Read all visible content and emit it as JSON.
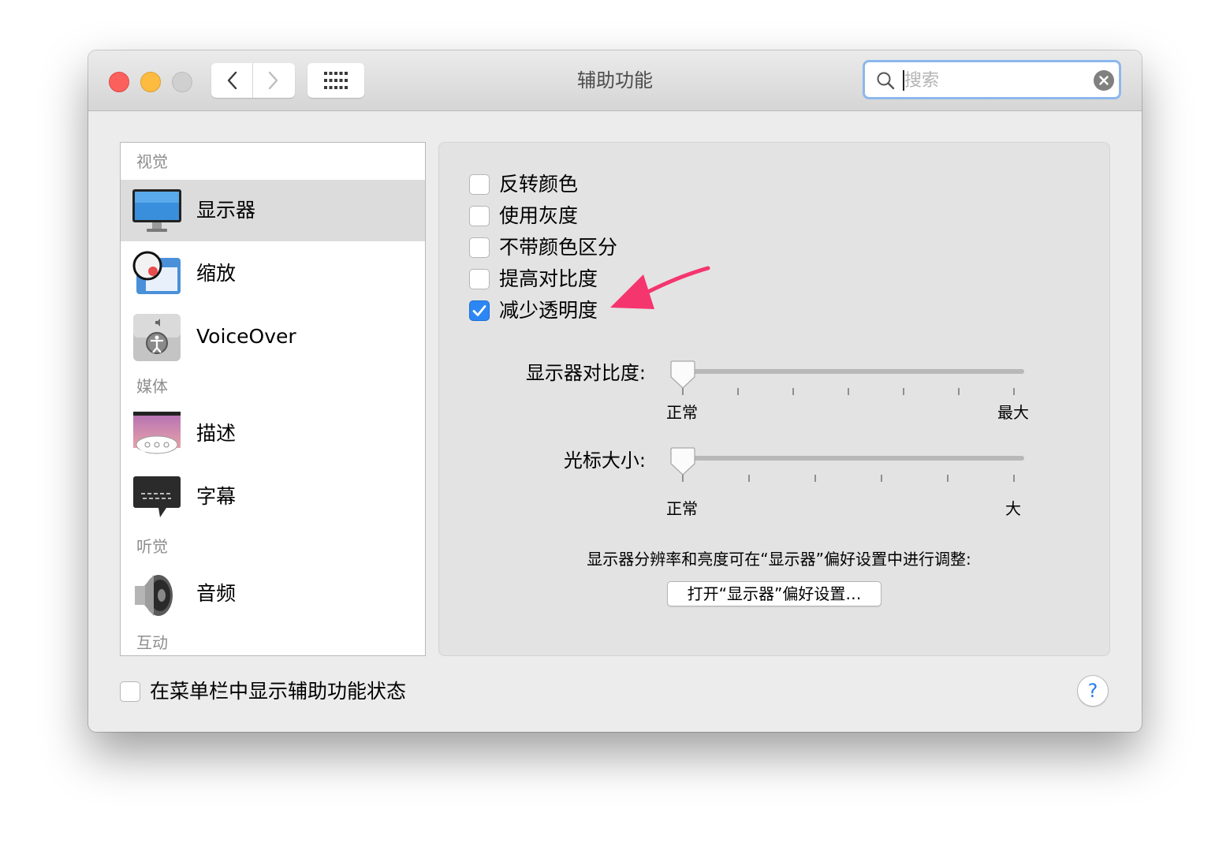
{
  "window": {
    "title": "辅助功能",
    "search_placeholder": "搜索"
  },
  "sidebar": {
    "sections": [
      {
        "header": "视觉",
        "items": [
          {
            "label": "显示器",
            "icon": "display-icon",
            "selected": true
          },
          {
            "label": "缩放",
            "icon": "zoom-icon"
          },
          {
            "label": "VoiceOver",
            "icon": "voiceover-icon"
          }
        ]
      },
      {
        "header": "媒体",
        "items": [
          {
            "label": "描述",
            "icon": "descriptions-icon"
          },
          {
            "label": "字幕",
            "icon": "captions-icon"
          }
        ]
      },
      {
        "header": "听觉",
        "items": [
          {
            "label": "音频",
            "icon": "speaker-icon"
          }
        ]
      },
      {
        "header": "互动",
        "items": []
      }
    ]
  },
  "display": {
    "options": [
      {
        "label": "反转颜色",
        "checked": false
      },
      {
        "label": "使用灰度",
        "checked": false
      },
      {
        "label": "不带颜色区分",
        "checked": false
      },
      {
        "label": "提高对比度",
        "checked": false
      },
      {
        "label": "减少透明度",
        "checked": true
      }
    ],
    "contrast": {
      "label": "显示器对比度:",
      "min_label": "正常",
      "max_label": "最大",
      "value": 0
    },
    "cursor": {
      "label": "光标大小:",
      "min_label": "正常",
      "max_label": "大",
      "value": 0
    },
    "note": "显示器分辨率和亮度可在“显示器”偏好设置中进行调整:",
    "open_button": "打开“显示器”偏好设置…"
  },
  "footer": {
    "show_status_label": "在菜单栏中显示辅助功能状态",
    "show_status_checked": false,
    "help_label": "?"
  },
  "colors": {
    "accent": "#2c87f5",
    "annotation_arrow": "#f5356e"
  }
}
